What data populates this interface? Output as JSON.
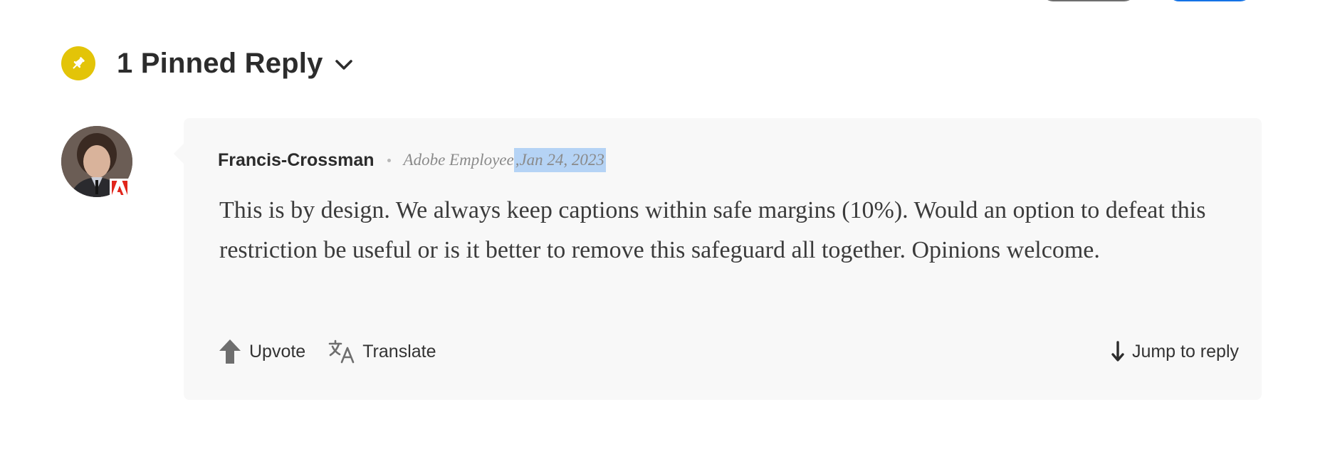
{
  "pinned": {
    "title": "1 Pinned Reply",
    "pin_color": "#e3c408",
    "icon": "pin-icon"
  },
  "reply": {
    "author": "Francis-Crossman",
    "role": "Adobe Employee",
    "separator": ",",
    "date": "Jan 24, 2023",
    "body": "This is by design. We always keep captions within safe margins (10%). Would an option to defeat this restriction be useful or is it better to remove this safeguard all together. Opinions welcome.",
    "badge": "adobe-logo-icon"
  },
  "actions": {
    "upvote_label": "Upvote",
    "translate_label": "Translate",
    "jump_label": "Jump to reply"
  },
  "colors": {
    "accent_blue": "#1473e6",
    "selection": "#b5d3f5",
    "card_bg": "#f8f8f8"
  }
}
